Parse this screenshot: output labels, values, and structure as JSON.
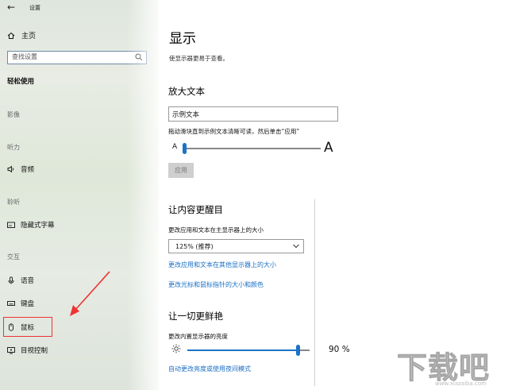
{
  "titlebar": {
    "back_glyph": "←",
    "app_title": "设置"
  },
  "sidebar": {
    "home_label": "主页",
    "search_placeholder": "查找设置",
    "section_title": "轻松使用",
    "groups": [
      {
        "label": "影像"
      },
      {
        "label": "听力"
      },
      {
        "label": "聆听"
      },
      {
        "label": "交互"
      }
    ],
    "items": {
      "audio": {
        "label": "音频",
        "icon": "speaker-icon"
      },
      "captions": {
        "label": "隐藏式字幕",
        "icon": "captions-icon"
      },
      "speech": {
        "label": "语音",
        "icon": "microphone-icon"
      },
      "keyboard": {
        "label": "键盘",
        "icon": "keyboard-icon"
      },
      "mouse": {
        "label": "鼠标",
        "icon": "mouse-icon"
      },
      "eye_control": {
        "label": "目视控制",
        "icon": "eye-control-icon"
      }
    }
  },
  "main": {
    "title": "显示",
    "description": "使显示器更易于查看。",
    "text_section": {
      "heading": "放大文本",
      "sample_text": "示例文本",
      "hint": "拖动滑块直到示例文本清晰可读，然后单击“应用”",
      "small_a": "A",
      "large_a": "A",
      "slider_level": 0,
      "apply_label": "应用"
    },
    "prominent_section": {
      "heading": "让内容更醒目",
      "size_label": "更改应用和文本在主显示器上的大小",
      "size_value": "125% (推荐)",
      "link_other_displays": "更改应用和文本在其他显示器上的大小",
      "link_pointer": "更改光标和鼠标指针的大小和颜色"
    },
    "vivid_section": {
      "heading": "让一切更鲜艳",
      "brightness_label": "更改内置显示器的亮度",
      "brightness_value": 90,
      "brightness_text": "90 %",
      "night_light_link": "自动更改亮度或使用夜间模式"
    }
  },
  "watermark": {
    "text": "下载吧",
    "url": "www.xiazaiba.com"
  },
  "colors": {
    "accent": "#1a73c8",
    "link": "#1a6fc4",
    "highlight": "#e33333"
  }
}
